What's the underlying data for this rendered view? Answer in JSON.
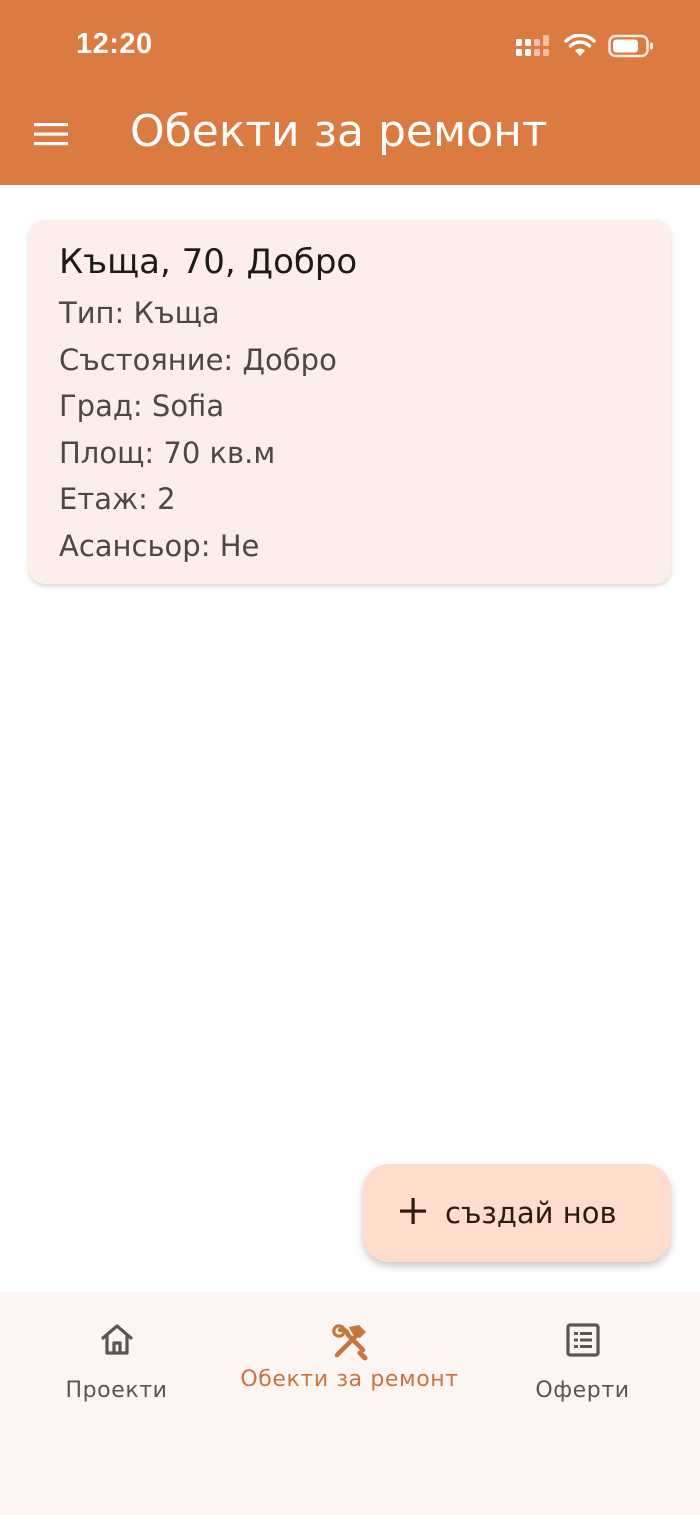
{
  "status_bar": {
    "time": "12:20",
    "icons": [
      "signal-icon",
      "wifi-icon",
      "battery-icon"
    ]
  },
  "app_bar": {
    "menu_icon": "menu-icon",
    "title": "Обекти за ремонт"
  },
  "property_card": {
    "title": "Къща, 70, Добро",
    "lines": [
      "Тип: Къща",
      "Състояние: Добро",
      "Град: Sofia",
      "Площ: 70 кв.м",
      "Етаж: 2",
      "Асансьор: Не"
    ]
  },
  "fab": {
    "icon": "plus-icon",
    "label": "създай нов"
  },
  "bottom_nav": {
    "items": [
      {
        "icon": "home-icon",
        "label": "Проекти",
        "active": false
      },
      {
        "icon": "hammer-wrench-icon",
        "label": "Обекти за ремонт",
        "active": true
      },
      {
        "icon": "list-icon",
        "label": "Оферти",
        "active": false
      }
    ]
  },
  "colors": {
    "app_bar": "#db7a41",
    "card_background": "#fdeee9",
    "fab_background": "#ffdccb",
    "nav_background": "#fdf5f2",
    "nav_active": "#c8743f",
    "nav_inactive": "#5a5452"
  }
}
